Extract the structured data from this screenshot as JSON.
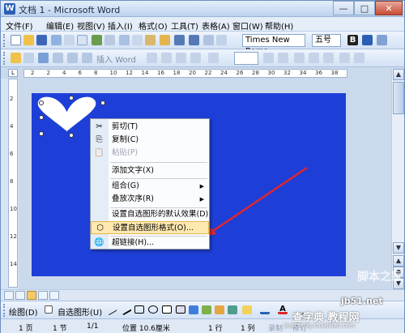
{
  "window": {
    "title": "文档 1 - Microsoft Word",
    "app_icon": "W",
    "controls": {
      "minimize": "—",
      "maximize": "□",
      "close": "✕"
    }
  },
  "menubar": {
    "items": [
      "文件(F)",
      "编辑(E)",
      "视图(V)",
      "插入(I)",
      "格式(O)",
      "工具(T)",
      "表格(A)",
      "窗口(W)",
      "帮助(H)"
    ]
  },
  "toolbar_standard": {
    "font_name": "Times New Roma",
    "font_size": "五号"
  },
  "toolbar_drawing_top": {
    "insert_word": "插入 Word"
  },
  "ruler": {
    "ticks": [
      "2",
      "2",
      "4",
      "6",
      "8",
      "10",
      "12",
      "14",
      "16",
      "18",
      "20",
      "22",
      "24",
      "26",
      "28",
      "30",
      "32",
      "34",
      "36",
      "38"
    ],
    "left_ticks": [
      "2",
      "4",
      "6",
      "8",
      "10",
      "12",
      "14"
    ],
    "corner": "L"
  },
  "context_menu": {
    "items": [
      {
        "label": "剪切(T)",
        "icon": "scissors-icon",
        "glyph": "✂",
        "disabled": false
      },
      {
        "label": "复制(C)",
        "icon": "copy-icon",
        "glyph": "⎘",
        "disabled": false
      },
      {
        "label": "粘贴(P)",
        "icon": "paste-icon",
        "glyph": "📋",
        "disabled": true
      },
      {
        "label": "添加文字(X)",
        "disabled": false
      },
      {
        "label": "组合(G)",
        "disabled": false,
        "submenu": true
      },
      {
        "label": "叠放次序(R)",
        "disabled": false,
        "submenu": true
      },
      {
        "label": "设置自选图形的默认效果(D)",
        "disabled": false
      },
      {
        "label": "设置自选图形格式(O)...",
        "icon": "format-shape-icon",
        "glyph": "⬡",
        "disabled": false,
        "highlighted": true
      },
      {
        "label": "超链接(H)...",
        "icon": "hyperlink-icon",
        "glyph": "🌐",
        "disabled": false
      }
    ],
    "submenu_glyph": "▶"
  },
  "drawbar": {
    "draw_label": "绘图(D)",
    "autoshape_label": "自选图形(U)"
  },
  "statusbar": {
    "page": "1 页",
    "section": "1 节",
    "page_of": "1/1",
    "position": "位置 10.6厘米",
    "line": "1 行",
    "column": "1 列",
    "rec": "录制",
    "trk": "修订"
  },
  "watermark": {
    "line1": "jb51.net",
    "line2": "查字典 教程网",
    "line3": "jiaocheng.chazidian.com",
    "line4": "脚本之家"
  },
  "colors": {
    "page_blue": "#1e3fd7",
    "annotation_red": "#e0262c",
    "highlight": "#ffe9b0"
  }
}
